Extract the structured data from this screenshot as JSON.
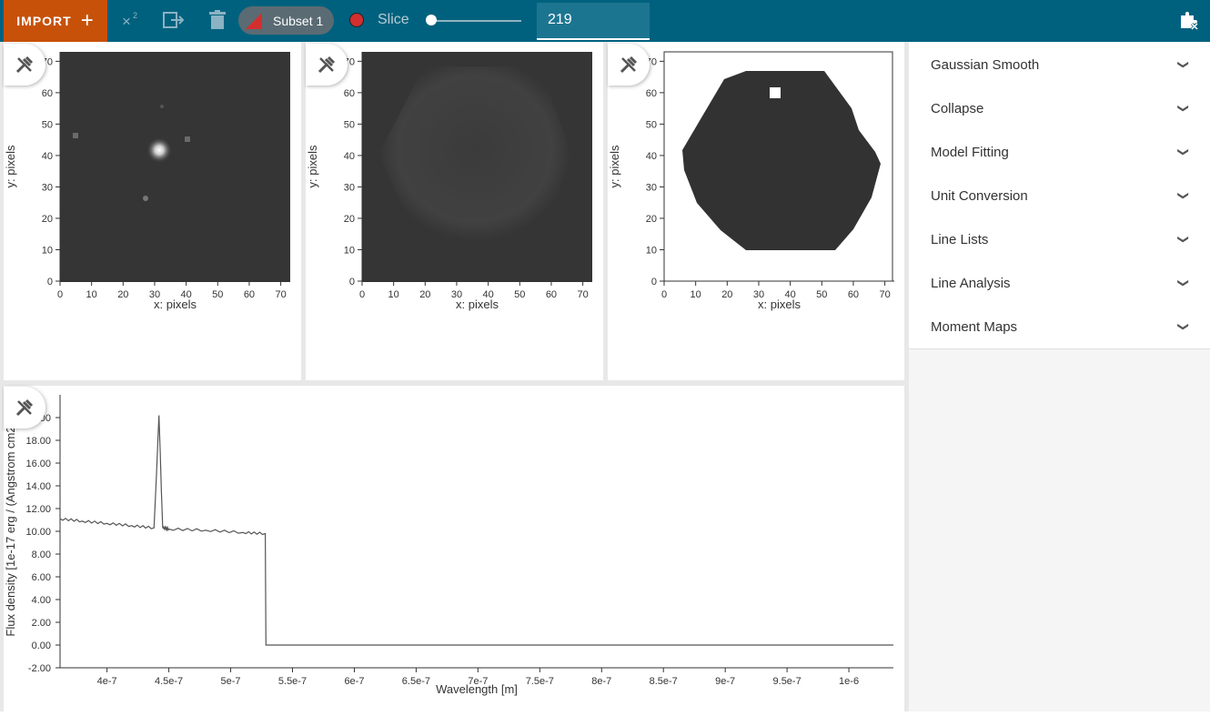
{
  "toolbar": {
    "import_label": "IMPORT",
    "import_plus": "+",
    "subset_label": "Subset 1",
    "slice_label": "Slice",
    "slice_value": "219",
    "subset_color": "#d32f2f",
    "slice_level": 0.0
  },
  "image_viewers": [
    {
      "ylabel": "y: pixels",
      "xlabel": "x: pixels"
    },
    {
      "ylabel": "y: pixels",
      "xlabel": "x: pixels"
    },
    {
      "ylabel": "y: pixels",
      "xlabel": "x: pixels"
    }
  ],
  "image_axes": {
    "x_ticks": [
      "0",
      "10",
      "20",
      "30",
      "40",
      "50",
      "60",
      "70"
    ],
    "y_ticks": [
      "0",
      "10",
      "20",
      "30",
      "40",
      "50",
      "60",
      "70"
    ]
  },
  "spectrum": {
    "xlabel": "Wavelength [m]",
    "ylabel": "Flux density [1e-17 erg / (Angstrom cm2",
    "x_ticks": [
      "4e-7",
      "4.5e-7",
      "5e-7",
      "5.5e-7",
      "6e-7",
      "6.5e-7",
      "7e-7",
      "7.5e-7",
      "8e-7",
      "8.5e-7",
      "9e-7",
      "9.5e-7",
      "1e-6"
    ],
    "y_ticks": [
      "-2.00",
      "0.00",
      "2.00",
      "4.00",
      "6.00",
      "8.00",
      "10.00",
      "12.00",
      "14.00",
      "16.00",
      "18.00",
      "00"
    ]
  },
  "chart_data": {
    "type": "line",
    "xlabel": "Wavelength [m]",
    "ylabel": "Flux density [1e-17 erg / (Angstrom cm2",
    "x": [
      3.62e-07,
      3.8e-07,
      4e-07,
      4.2e-07,
      4.38e-07,
      4.4e-07,
      4.42e-07,
      4.43e-07,
      4.44e-07,
      4.45e-07,
      4.46e-07,
      4.5e-07,
      4.8e-07,
      5.1e-07,
      5.28e-07,
      5.285e-07,
      6e-07,
      8e-07,
      1.036e-06
    ],
    "y": [
      11.1,
      10.9,
      10.7,
      10.5,
      10.3,
      15.0,
      20.2,
      17.0,
      13.5,
      10.4,
      10.3,
      10.2,
      10.1,
      9.9,
      9.8,
      0.0,
      0.0,
      0.0,
      0.0
    ],
    "xlim": [
      3.62e-07,
      1.036e-06
    ],
    "ylim": [
      -2.0,
      22.0
    ]
  },
  "plugins": [
    {
      "label": "Gaussian Smooth"
    },
    {
      "label": "Collapse"
    },
    {
      "label": "Model Fitting"
    },
    {
      "label": "Unit Conversion"
    },
    {
      "label": "Line Lists"
    },
    {
      "label": "Line Analysis"
    },
    {
      "label": "Moment Maps"
    }
  ]
}
